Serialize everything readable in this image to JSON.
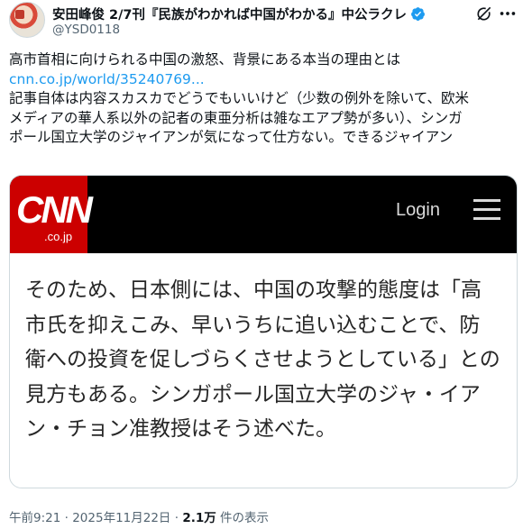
{
  "author": {
    "display_name": "安田峰俊 2/7刊『民族がわかれば中国がわかる』中公ラクレ",
    "handle": "@YSD0118"
  },
  "tweet": {
    "lines": [
      "高市首相に向けられる中国の激怒、背景にある本当の理由とは",
      "記事自体は内容スカスカでどうでもいいけど（少数の例外を除いて、欧米",
      "メディアの華人系以外の記者の東亜分析は雑なエアプ勢が多い）、シンガ",
      "ポール国立大学のジャイアンが気になって仕方ない。できるジャイアン"
    ],
    "link": "cnn.co.jp/world/35240769..."
  },
  "card": {
    "logo_text": "CNN",
    "logo_sub": ".co.jp",
    "login_label": "Login",
    "quote_lines": [
      "そのため、日本側には、中国の攻撃的態度は「高",
      "市氏を抑えこみ、早いうちに追い込むことで、防",
      "衛への投資を促しづらくさせようとしている」との",
      "見方もある。シンガポール国立大学のジャ・イア",
      "ン・チョン准教授はそう述べた。"
    ]
  },
  "meta": {
    "time": "午前9:21",
    "sep": "·",
    "date": "2025年11月22日",
    "views_count": "2.1万",
    "views_label": "件の表示"
  },
  "icons": {
    "verified": "verified-badge-icon",
    "grok": "grok-icon",
    "more": "more-icon",
    "menu": "hamburger-menu-icon"
  },
  "colors": {
    "link": "#1d9bf0",
    "verified": "#1d9bf0",
    "cnn_red": "#cc0000",
    "secondary_text": "#536471"
  }
}
